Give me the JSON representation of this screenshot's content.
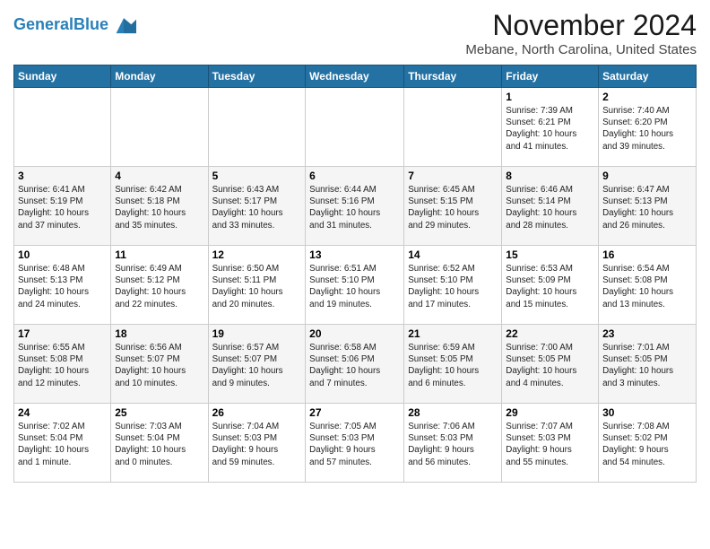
{
  "header": {
    "logo_line1": "General",
    "logo_line2": "Blue",
    "month_title": "November 2024",
    "location": "Mebane, North Carolina, United States"
  },
  "columns": [
    "Sunday",
    "Monday",
    "Tuesday",
    "Wednesday",
    "Thursday",
    "Friday",
    "Saturday"
  ],
  "weeks": [
    [
      {
        "day": "",
        "info": ""
      },
      {
        "day": "",
        "info": ""
      },
      {
        "day": "",
        "info": ""
      },
      {
        "day": "",
        "info": ""
      },
      {
        "day": "",
        "info": ""
      },
      {
        "day": "1",
        "info": "Sunrise: 7:39 AM\nSunset: 6:21 PM\nDaylight: 10 hours\nand 41 minutes."
      },
      {
        "day": "2",
        "info": "Sunrise: 7:40 AM\nSunset: 6:20 PM\nDaylight: 10 hours\nand 39 minutes."
      }
    ],
    [
      {
        "day": "3",
        "info": "Sunrise: 6:41 AM\nSunset: 5:19 PM\nDaylight: 10 hours\nand 37 minutes."
      },
      {
        "day": "4",
        "info": "Sunrise: 6:42 AM\nSunset: 5:18 PM\nDaylight: 10 hours\nand 35 minutes."
      },
      {
        "day": "5",
        "info": "Sunrise: 6:43 AM\nSunset: 5:17 PM\nDaylight: 10 hours\nand 33 minutes."
      },
      {
        "day": "6",
        "info": "Sunrise: 6:44 AM\nSunset: 5:16 PM\nDaylight: 10 hours\nand 31 minutes."
      },
      {
        "day": "7",
        "info": "Sunrise: 6:45 AM\nSunset: 5:15 PM\nDaylight: 10 hours\nand 29 minutes."
      },
      {
        "day": "8",
        "info": "Sunrise: 6:46 AM\nSunset: 5:14 PM\nDaylight: 10 hours\nand 28 minutes."
      },
      {
        "day": "9",
        "info": "Sunrise: 6:47 AM\nSunset: 5:13 PM\nDaylight: 10 hours\nand 26 minutes."
      }
    ],
    [
      {
        "day": "10",
        "info": "Sunrise: 6:48 AM\nSunset: 5:13 PM\nDaylight: 10 hours\nand 24 minutes."
      },
      {
        "day": "11",
        "info": "Sunrise: 6:49 AM\nSunset: 5:12 PM\nDaylight: 10 hours\nand 22 minutes."
      },
      {
        "day": "12",
        "info": "Sunrise: 6:50 AM\nSunset: 5:11 PM\nDaylight: 10 hours\nand 20 minutes."
      },
      {
        "day": "13",
        "info": "Sunrise: 6:51 AM\nSunset: 5:10 PM\nDaylight: 10 hours\nand 19 minutes."
      },
      {
        "day": "14",
        "info": "Sunrise: 6:52 AM\nSunset: 5:10 PM\nDaylight: 10 hours\nand 17 minutes."
      },
      {
        "day": "15",
        "info": "Sunrise: 6:53 AM\nSunset: 5:09 PM\nDaylight: 10 hours\nand 15 minutes."
      },
      {
        "day": "16",
        "info": "Sunrise: 6:54 AM\nSunset: 5:08 PM\nDaylight: 10 hours\nand 13 minutes."
      }
    ],
    [
      {
        "day": "17",
        "info": "Sunrise: 6:55 AM\nSunset: 5:08 PM\nDaylight: 10 hours\nand 12 minutes."
      },
      {
        "day": "18",
        "info": "Sunrise: 6:56 AM\nSunset: 5:07 PM\nDaylight: 10 hours\nand 10 minutes."
      },
      {
        "day": "19",
        "info": "Sunrise: 6:57 AM\nSunset: 5:07 PM\nDaylight: 10 hours\nand 9 minutes."
      },
      {
        "day": "20",
        "info": "Sunrise: 6:58 AM\nSunset: 5:06 PM\nDaylight: 10 hours\nand 7 minutes."
      },
      {
        "day": "21",
        "info": "Sunrise: 6:59 AM\nSunset: 5:05 PM\nDaylight: 10 hours\nand 6 minutes."
      },
      {
        "day": "22",
        "info": "Sunrise: 7:00 AM\nSunset: 5:05 PM\nDaylight: 10 hours\nand 4 minutes."
      },
      {
        "day": "23",
        "info": "Sunrise: 7:01 AM\nSunset: 5:05 PM\nDaylight: 10 hours\nand 3 minutes."
      }
    ],
    [
      {
        "day": "24",
        "info": "Sunrise: 7:02 AM\nSunset: 5:04 PM\nDaylight: 10 hours\nand 1 minute."
      },
      {
        "day": "25",
        "info": "Sunrise: 7:03 AM\nSunset: 5:04 PM\nDaylight: 10 hours\nand 0 minutes."
      },
      {
        "day": "26",
        "info": "Sunrise: 7:04 AM\nSunset: 5:03 PM\nDaylight: 9 hours\nand 59 minutes."
      },
      {
        "day": "27",
        "info": "Sunrise: 7:05 AM\nSunset: 5:03 PM\nDaylight: 9 hours\nand 57 minutes."
      },
      {
        "day": "28",
        "info": "Sunrise: 7:06 AM\nSunset: 5:03 PM\nDaylight: 9 hours\nand 56 minutes."
      },
      {
        "day": "29",
        "info": "Sunrise: 7:07 AM\nSunset: 5:03 PM\nDaylight: 9 hours\nand 55 minutes."
      },
      {
        "day": "30",
        "info": "Sunrise: 7:08 AM\nSunset: 5:02 PM\nDaylight: 9 hours\nand 54 minutes."
      }
    ]
  ]
}
